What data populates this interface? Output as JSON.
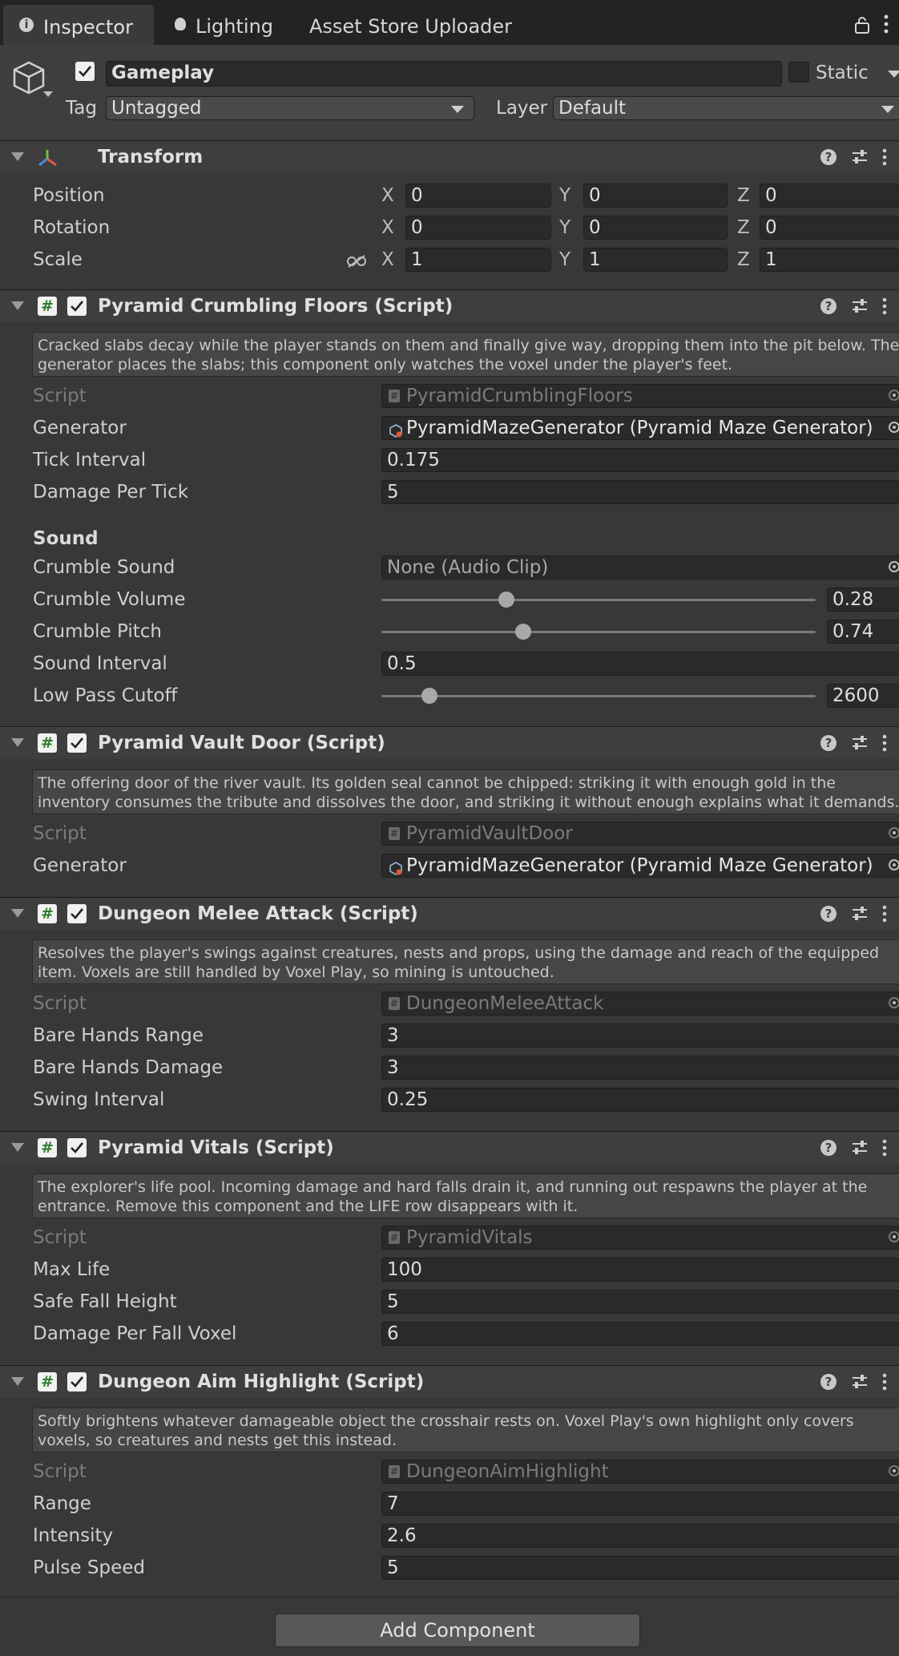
{
  "tabs": [
    {
      "label": "Inspector",
      "icon": "info-icon"
    },
    {
      "label": "Lighting",
      "icon": "lightbulb-icon"
    },
    {
      "label": "Asset Store Uploader"
    }
  ],
  "gameobject": {
    "name": "Gameplay",
    "active": true,
    "static_label": "Static",
    "tag_label": "Tag",
    "tag_value": "Untagged",
    "layer_label": "Layer",
    "layer_value": "Default"
  },
  "transform": {
    "title": "Transform",
    "rows": [
      {
        "label": "Position",
        "x": "0",
        "y": "0",
        "z": "0"
      },
      {
        "label": "Rotation",
        "x": "0",
        "y": "0",
        "z": "0"
      },
      {
        "label": "Scale",
        "x": "1",
        "y": "1",
        "z": "1"
      }
    ],
    "axes": [
      "X",
      "Y",
      "Z"
    ]
  },
  "crumbling": {
    "title": "Pyramid Crumbling Floors (Script)",
    "desc": "Cracked slabs decay while the player stands on them and finally give way, dropping them into the pit below. The generator places the slabs; this component only watches the voxel under the player's feet.",
    "script_label": "Script",
    "script_value": "PyramidCrumblingFloors",
    "generator_label": "Generator",
    "generator_value": "PyramidMazeGenerator (Pyramid Maze Generator)",
    "tick_label": "Tick Interval",
    "tick_value": "0.175",
    "damage_label": "Damage Per Tick",
    "damage_value": "5",
    "sound_header": "Sound",
    "crumble_sound_label": "Crumble Sound",
    "crumble_sound_value": "None (Audio Clip)",
    "crumble_volume_label": "Crumble Volume",
    "crumble_volume_value": "0.28",
    "crumble_pitch_label": "Crumble Pitch",
    "crumble_pitch_value": "0.74",
    "sound_interval_label": "Sound Interval",
    "sound_interval_value": "0.5",
    "low_pass_label": "Low Pass Cutoff",
    "low_pass_value": "2600"
  },
  "vault": {
    "title": "Pyramid Vault Door (Script)",
    "desc": "The offering door of the river vault. Its golden seal cannot be chipped: striking it with enough gold in the inventory consumes the tribute and dissolves the door, and striking it without enough explains what it demands.",
    "script_label": "Script",
    "script_value": "PyramidVaultDoor",
    "generator_label": "Generator",
    "generator_value": "PyramidMazeGenerator (Pyramid Maze Generator)"
  },
  "melee": {
    "title": "Dungeon Melee Attack (Script)",
    "desc": "Resolves the player's swings against creatures, nests and props, using the damage and reach of the equipped item. Voxels are still handled by Voxel Play, so mining is untouched.",
    "script_label": "Script",
    "script_value": "DungeonMeleeAttack",
    "range_label": "Bare Hands Range",
    "range_value": "3",
    "damage_label": "Bare Hands Damage",
    "damage_value": "3",
    "swing_label": "Swing Interval",
    "swing_value": "0.25"
  },
  "vitals": {
    "title": "Pyramid Vitals (Script)",
    "desc": "The explorer's life pool. Incoming damage and hard falls drain it, and running out respawns the player at the entrance. Remove this component and the LIFE row disappears with it.",
    "script_label": "Script",
    "script_value": "PyramidVitals",
    "max_life_label": "Max Life",
    "max_life_value": "100",
    "safe_fall_label": "Safe Fall Height",
    "safe_fall_value": "5",
    "fall_damage_label": "Damage Per Fall Voxel",
    "fall_damage_value": "6"
  },
  "aim": {
    "title": "Dungeon Aim Highlight (Script)",
    "desc": "Softly brightens whatever damageable object the crosshair rests on. Voxel Play's own highlight only covers voxels, so creatures and nests get this instead.",
    "script_label": "Script",
    "script_value": "DungeonAimHighlight",
    "range_label": "Range",
    "range_value": "7",
    "intensity_label": "Intensity",
    "intensity_value": "2.6",
    "pulse_label": "Pulse Speed",
    "pulse_value": "5"
  },
  "add_component_label": "Add Component",
  "colors": {
    "background": "#383838",
    "header": "#3e3e3e",
    "field": "#2a2a2a",
    "tabbar": "#232323"
  }
}
